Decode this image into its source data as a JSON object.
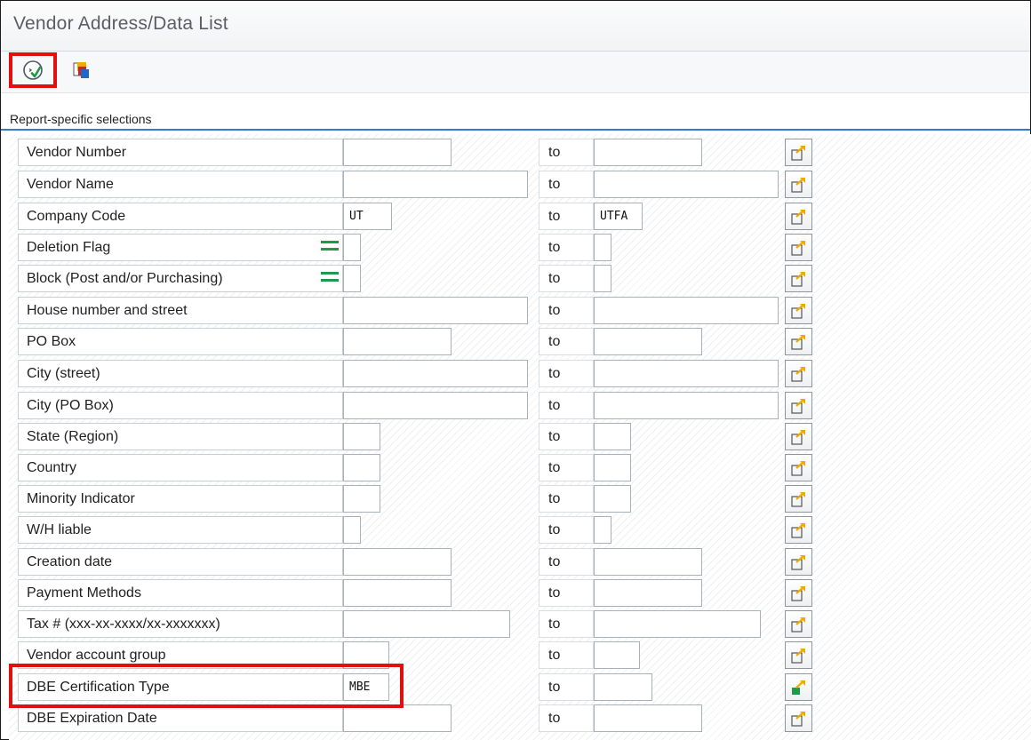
{
  "window": {
    "title": "Vendor Address/Data List"
  },
  "toolbar": {
    "execute_icon": "execute-icon",
    "variant_icon": "get-variant-icon"
  },
  "section": {
    "title": "Report-specific selections"
  },
  "common": {
    "to_label": "to"
  },
  "rows": [
    {
      "label": "Vendor Number",
      "from": "",
      "to": "",
      "has_sign": false
    },
    {
      "label": "Vendor Name",
      "from": "",
      "to": "",
      "has_sign": false
    },
    {
      "label": "Company Code",
      "from": "UT",
      "to": "UTFA",
      "has_sign": false
    },
    {
      "label": "Deletion Flag",
      "from": "",
      "to": "",
      "has_sign": true
    },
    {
      "label": "Block (Post and/or Purchasing)",
      "from": "",
      "to": "",
      "has_sign": true
    },
    {
      "label": "House number and street",
      "from": "",
      "to": "",
      "has_sign": false
    },
    {
      "label": "PO Box",
      "from": "",
      "to": "",
      "has_sign": false
    },
    {
      "label": "City (street)",
      "from": "",
      "to": "",
      "has_sign": false
    },
    {
      "label": "City (PO Box)",
      "from": "",
      "to": "",
      "has_sign": false
    },
    {
      "label": "State (Region)",
      "from": "",
      "to": "",
      "has_sign": false
    },
    {
      "label": "Country",
      "from": "",
      "to": "",
      "has_sign": false
    },
    {
      "label": "Minority Indicator",
      "from": "",
      "to": "",
      "has_sign": false
    },
    {
      "label": "W/H liable",
      "from": "",
      "to": "",
      "has_sign": false
    },
    {
      "label": "Creation date",
      "from": "",
      "to": "",
      "has_sign": false
    },
    {
      "label": "Payment Methods",
      "from": "",
      "to": "",
      "has_sign": false
    },
    {
      "label": "Tax # (xxx-xx-xxxx/xx-xxxxxxx)",
      "from": "",
      "to": "",
      "has_sign": false
    },
    {
      "label": "Vendor account group",
      "from": "",
      "to": "",
      "has_sign": false
    },
    {
      "label": "DBE Certification Type",
      "from": "MBE",
      "to": "",
      "has_sign": false,
      "multi_active": true
    },
    {
      "label": "DBE Expiration Date",
      "from": "",
      "to": "",
      "has_sign": false
    }
  ],
  "colors": {
    "accent": "#2c7fc7",
    "highlight": "#e01010",
    "sign": "#1e9a4a",
    "arrow": "#f2a900"
  }
}
